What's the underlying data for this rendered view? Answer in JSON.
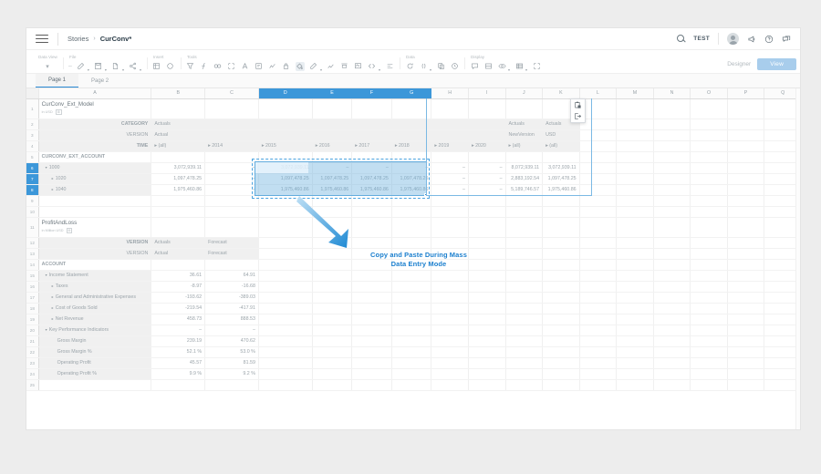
{
  "header": {
    "menu_icon": "hamburger-icon",
    "breadcrumb_root": "Stories",
    "breadcrumb_sep": "›",
    "breadcrumb_current": "CurConv*",
    "search_icon": "search-icon",
    "user": "TEST",
    "avatar": "user-avatar",
    "notify_icon": "megaphone-icon",
    "help_icon": "help-circle-icon",
    "chat_icon": "chat-bubble-icon"
  },
  "toolbar": {
    "groups": [
      {
        "label": "Data View",
        "icons": [
          "chevron-down-icon"
        ]
      },
      {
        "label": "File",
        "icons": [
          "dash-icon",
          "pen-edit-icon",
          "save-icon",
          "export-icon",
          "share-icon"
        ]
      },
      {
        "label": "Insert",
        "icons": [
          "table-icon",
          "shape-icon"
        ]
      },
      {
        "label": "Tools",
        "icons": [
          "filter-icon",
          "formula-icon",
          "link-icon",
          "expand-icon",
          "font-icon",
          "note-icon",
          "distribute-icon",
          "align-icon",
          "chart-icon",
          "lock-icon",
          "paint-icon",
          "style-icon"
        ]
      },
      {
        "label": "Data",
        "icons": [
          "refresh-icon",
          "parentheses-icon",
          "copy-icon",
          "history-icon"
        ]
      },
      {
        "label": "Display",
        "icons": [
          "comment-icon",
          "panel-icon",
          "visibility-icon",
          "grid-icon",
          "fullscreen-icon"
        ]
      }
    ],
    "designer_label": "Designer",
    "view_button": "View"
  },
  "page_tabs": [
    {
      "label": "Page 1",
      "active": true
    },
    {
      "label": "Page 2",
      "active": false
    }
  ],
  "grid": {
    "columns": [
      "A",
      "B",
      "C",
      "D",
      "E",
      "F",
      "G",
      "H",
      "I",
      "J",
      "K",
      "L",
      "M",
      "N",
      "O",
      "P",
      "Q"
    ],
    "selected_columns": [
      "D",
      "E",
      "F",
      "G"
    ],
    "rows": [
      "1",
      "2",
      "3",
      "4",
      "5",
      "6",
      "7",
      "8",
      "9",
      "10",
      "11",
      "12",
      "13",
      "14",
      "15",
      "16",
      "17",
      "18",
      "19",
      "20",
      "21",
      "22",
      "23",
      "24",
      "25"
    ],
    "selected_rows": [
      "6",
      "7",
      "8"
    ]
  },
  "model1": {
    "title": "CurConv_Ext_Model",
    "subtitle": "in USD",
    "chip": "⊞",
    "category_label": "CATEGORY",
    "category_value": "Actuals",
    "version_label": "VERSION",
    "version_value": "Actual",
    "time_label": "TIME",
    "time_values": [
      "▸ (all)",
      "▸ 2014",
      "▸ 2015",
      "▸ 2016",
      "▸ 2017",
      "▸ 2018",
      "▸ 2019",
      "▸ 2020"
    ],
    "extra_headers": [
      {
        "cat": "Actuals",
        "ver": "NewVersion",
        "time": "▸ (all)"
      },
      {
        "cat": "Actuals",
        "ver": "USD",
        "time": "▸ (all)"
      }
    ],
    "account_label": "CURCONV_EXT_ACCOUNT",
    "rows": [
      {
        "name": "1000",
        "indent": 1,
        "tri": "▾",
        "values": [
          "3,072,939.11",
          "–",
          "3,072,939.11",
          "–",
          "–",
          "–",
          "–",
          "–",
          "8,072,939.11",
          "3,072,939.11"
        ]
      },
      {
        "name": "1020",
        "indent": 2,
        "tri": "▸",
        "values": [
          "1,097,478.25",
          "–",
          "1,097,478.25",
          "1,097,478.25",
          "1,097,478.25",
          "1,097,478.25",
          "–",
          "–",
          "2,883,192.54",
          "1,097,478.25"
        ]
      },
      {
        "name": "1040",
        "indent": 2,
        "tri": "▸",
        "values": [
          "1,975,460.86",
          "–",
          "1,975,460.86",
          "1,975,460.86",
          "1,975,460.86",
          "1,975,460.86",
          "–",
          "–",
          "5,189,746.57",
          "1,975,460.86"
        ]
      }
    ]
  },
  "model2": {
    "title": "ProfitAndLoss",
    "subtitle": "in Million USD",
    "chip": "⊞",
    "version_label": "VERSION",
    "version_label2": "VERSION",
    "version_headers": [
      "Actuals",
      "Forecast"
    ],
    "version_values": [
      "Actual",
      "Forecast"
    ],
    "account_label": "ACCOUNT",
    "rows": [
      {
        "name": "Income Statement",
        "indent": 1,
        "tri": "▾",
        "values": [
          "36.61",
          "64.91"
        ]
      },
      {
        "name": "Taxes",
        "indent": 2,
        "tri": "▸",
        "values": [
          "-8.97",
          "-16.68"
        ]
      },
      {
        "name": "General and Administrative Expenses",
        "indent": 2,
        "tri": "▸",
        "values": [
          "-193.62",
          "-389.03"
        ]
      },
      {
        "name": "Cost of Goods Sold",
        "indent": 2,
        "tri": "▸",
        "values": [
          "-219.54",
          "-417.91"
        ]
      },
      {
        "name": "Net Revenue",
        "indent": 2,
        "tri": "▸",
        "values": [
          "458.73",
          "888.53"
        ]
      },
      {
        "name": "Key Performance Indicators",
        "indent": 1,
        "tri": "▾",
        "values": [
          "–",
          "–"
        ]
      },
      {
        "name": "Gross Margin",
        "indent": 3,
        "tri": "",
        "values": [
          "239.19",
          "470.62"
        ]
      },
      {
        "name": "Gross Margin %",
        "indent": 3,
        "tri": "",
        "values": [
          "52.1 %",
          "53.0 %"
        ]
      },
      {
        "name": "Operating Profit",
        "indent": 3,
        "tri": "",
        "values": [
          "45.57",
          "81.59"
        ]
      },
      {
        "name": "Operating Profit %",
        "indent": 3,
        "tri": "",
        "values": [
          "9.9 %",
          "9.2 %"
        ]
      }
    ]
  },
  "popup": {
    "icons": [
      "paste-options-icon",
      "insert-copied-cells-icon"
    ]
  },
  "annotation": {
    "line1": "Copy and Paste During Mass",
    "line2": "Data Entry Mode",
    "color": "#1b7fce"
  }
}
